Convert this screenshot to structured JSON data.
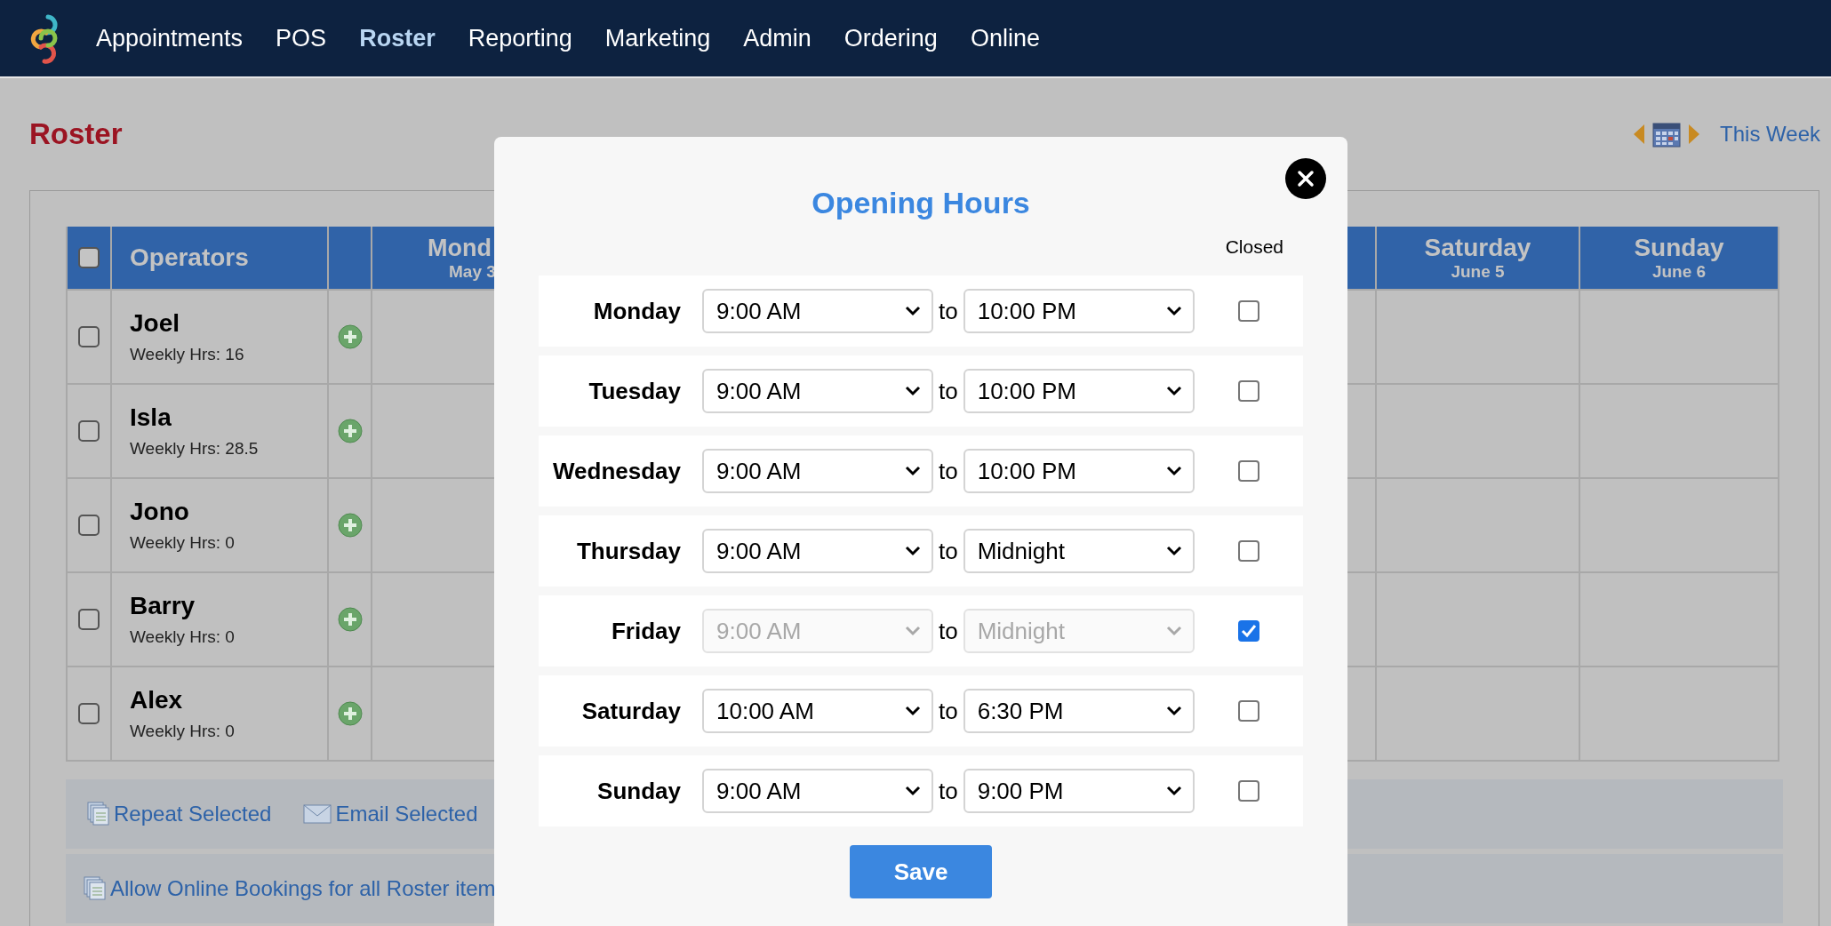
{
  "nav": {
    "items": [
      {
        "label": "Appointments",
        "selected": false
      },
      {
        "label": "POS",
        "selected": false
      },
      {
        "label": "Roster",
        "selected": true
      },
      {
        "label": "Reporting",
        "selected": false
      },
      {
        "label": "Marketing",
        "selected": false
      },
      {
        "label": "Admin",
        "selected": false
      },
      {
        "label": "Ordering",
        "selected": false
      },
      {
        "label": "Online",
        "selected": false
      }
    ]
  },
  "page": {
    "title": "Roster",
    "this_week": "This Week"
  },
  "table": {
    "header_checked": false,
    "operators_heading": "Operators",
    "days": [
      {
        "name": "Mond",
        "date": "May 3"
      },
      {
        "name": "Saturday",
        "date": "June 5"
      },
      {
        "name": "Sunday",
        "date": "June 6"
      }
    ],
    "rows": [
      {
        "name": "Joel",
        "hours": "Weekly Hrs: 16",
        "checked": false
      },
      {
        "name": "Isla",
        "hours": "Weekly Hrs: 28.5",
        "checked": false
      },
      {
        "name": "Jono",
        "hours": "Weekly Hrs: 0",
        "checked": false
      },
      {
        "name": "Barry",
        "hours": "Weekly Hrs: 0",
        "checked": false
      },
      {
        "name": "Alex",
        "hours": "Weekly Hrs: 0",
        "checked": false
      }
    ]
  },
  "actions": [
    {
      "label": "Repeat Selected",
      "kind": "repeat"
    },
    {
      "label": "Email Selected",
      "kind": "email"
    }
  ],
  "bulk_action": {
    "label": "Allow Online Bookings for all Roster item"
  },
  "modal": {
    "title": "Opening Hours",
    "closed_heading": "Closed",
    "save": "Save",
    "days": [
      {
        "day": "Monday",
        "open": "9:00 AM",
        "to": "to",
        "close": "10:00 PM",
        "closed": false
      },
      {
        "day": "Tuesday",
        "open": "9:00 AM",
        "to": "to",
        "close": "10:00 PM",
        "closed": false
      },
      {
        "day": "Wednesday",
        "open": "9:00 AM",
        "to": "to",
        "close": "10:00 PM",
        "closed": false
      },
      {
        "day": "Thursday",
        "open": "9:00 AM",
        "to": "to",
        "close": "Midnight",
        "closed": false
      },
      {
        "day": "Friday",
        "open": "9:00 AM",
        "to": "to",
        "close": "Midnight",
        "closed": true
      },
      {
        "day": "Saturday",
        "open": "10:00 AM",
        "to": "to",
        "close": "6:30 PM",
        "closed": false
      },
      {
        "day": "Sunday",
        "open": "9:00 AM",
        "to": "to",
        "close": "9:00 PM",
        "closed": false
      }
    ]
  }
}
